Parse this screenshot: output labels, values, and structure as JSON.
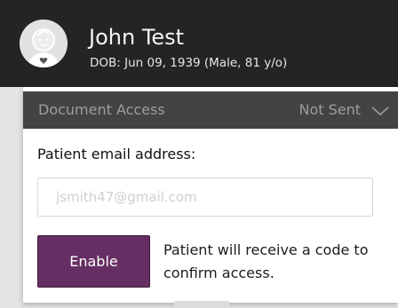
{
  "patient": {
    "name": "John Test",
    "dob_line": "DOB: Jun 09, 1939 (Male, 81 y/o)"
  },
  "document_access": {
    "title": "Document Access",
    "status": "Not Sent",
    "email_label": "Patient email address:",
    "email_value": "",
    "email_placeholder": "jsmith47@gmail.com",
    "enable_label": "Enable",
    "helper_text": "Patient will receive a code to confirm access."
  },
  "colors": {
    "header_bg": "#242424",
    "section_bar_bg": "#434343",
    "accent_button": "#662f63"
  },
  "icons": {
    "avatar": "baby-avatar-icon",
    "expand": "chevron-down-icon"
  }
}
